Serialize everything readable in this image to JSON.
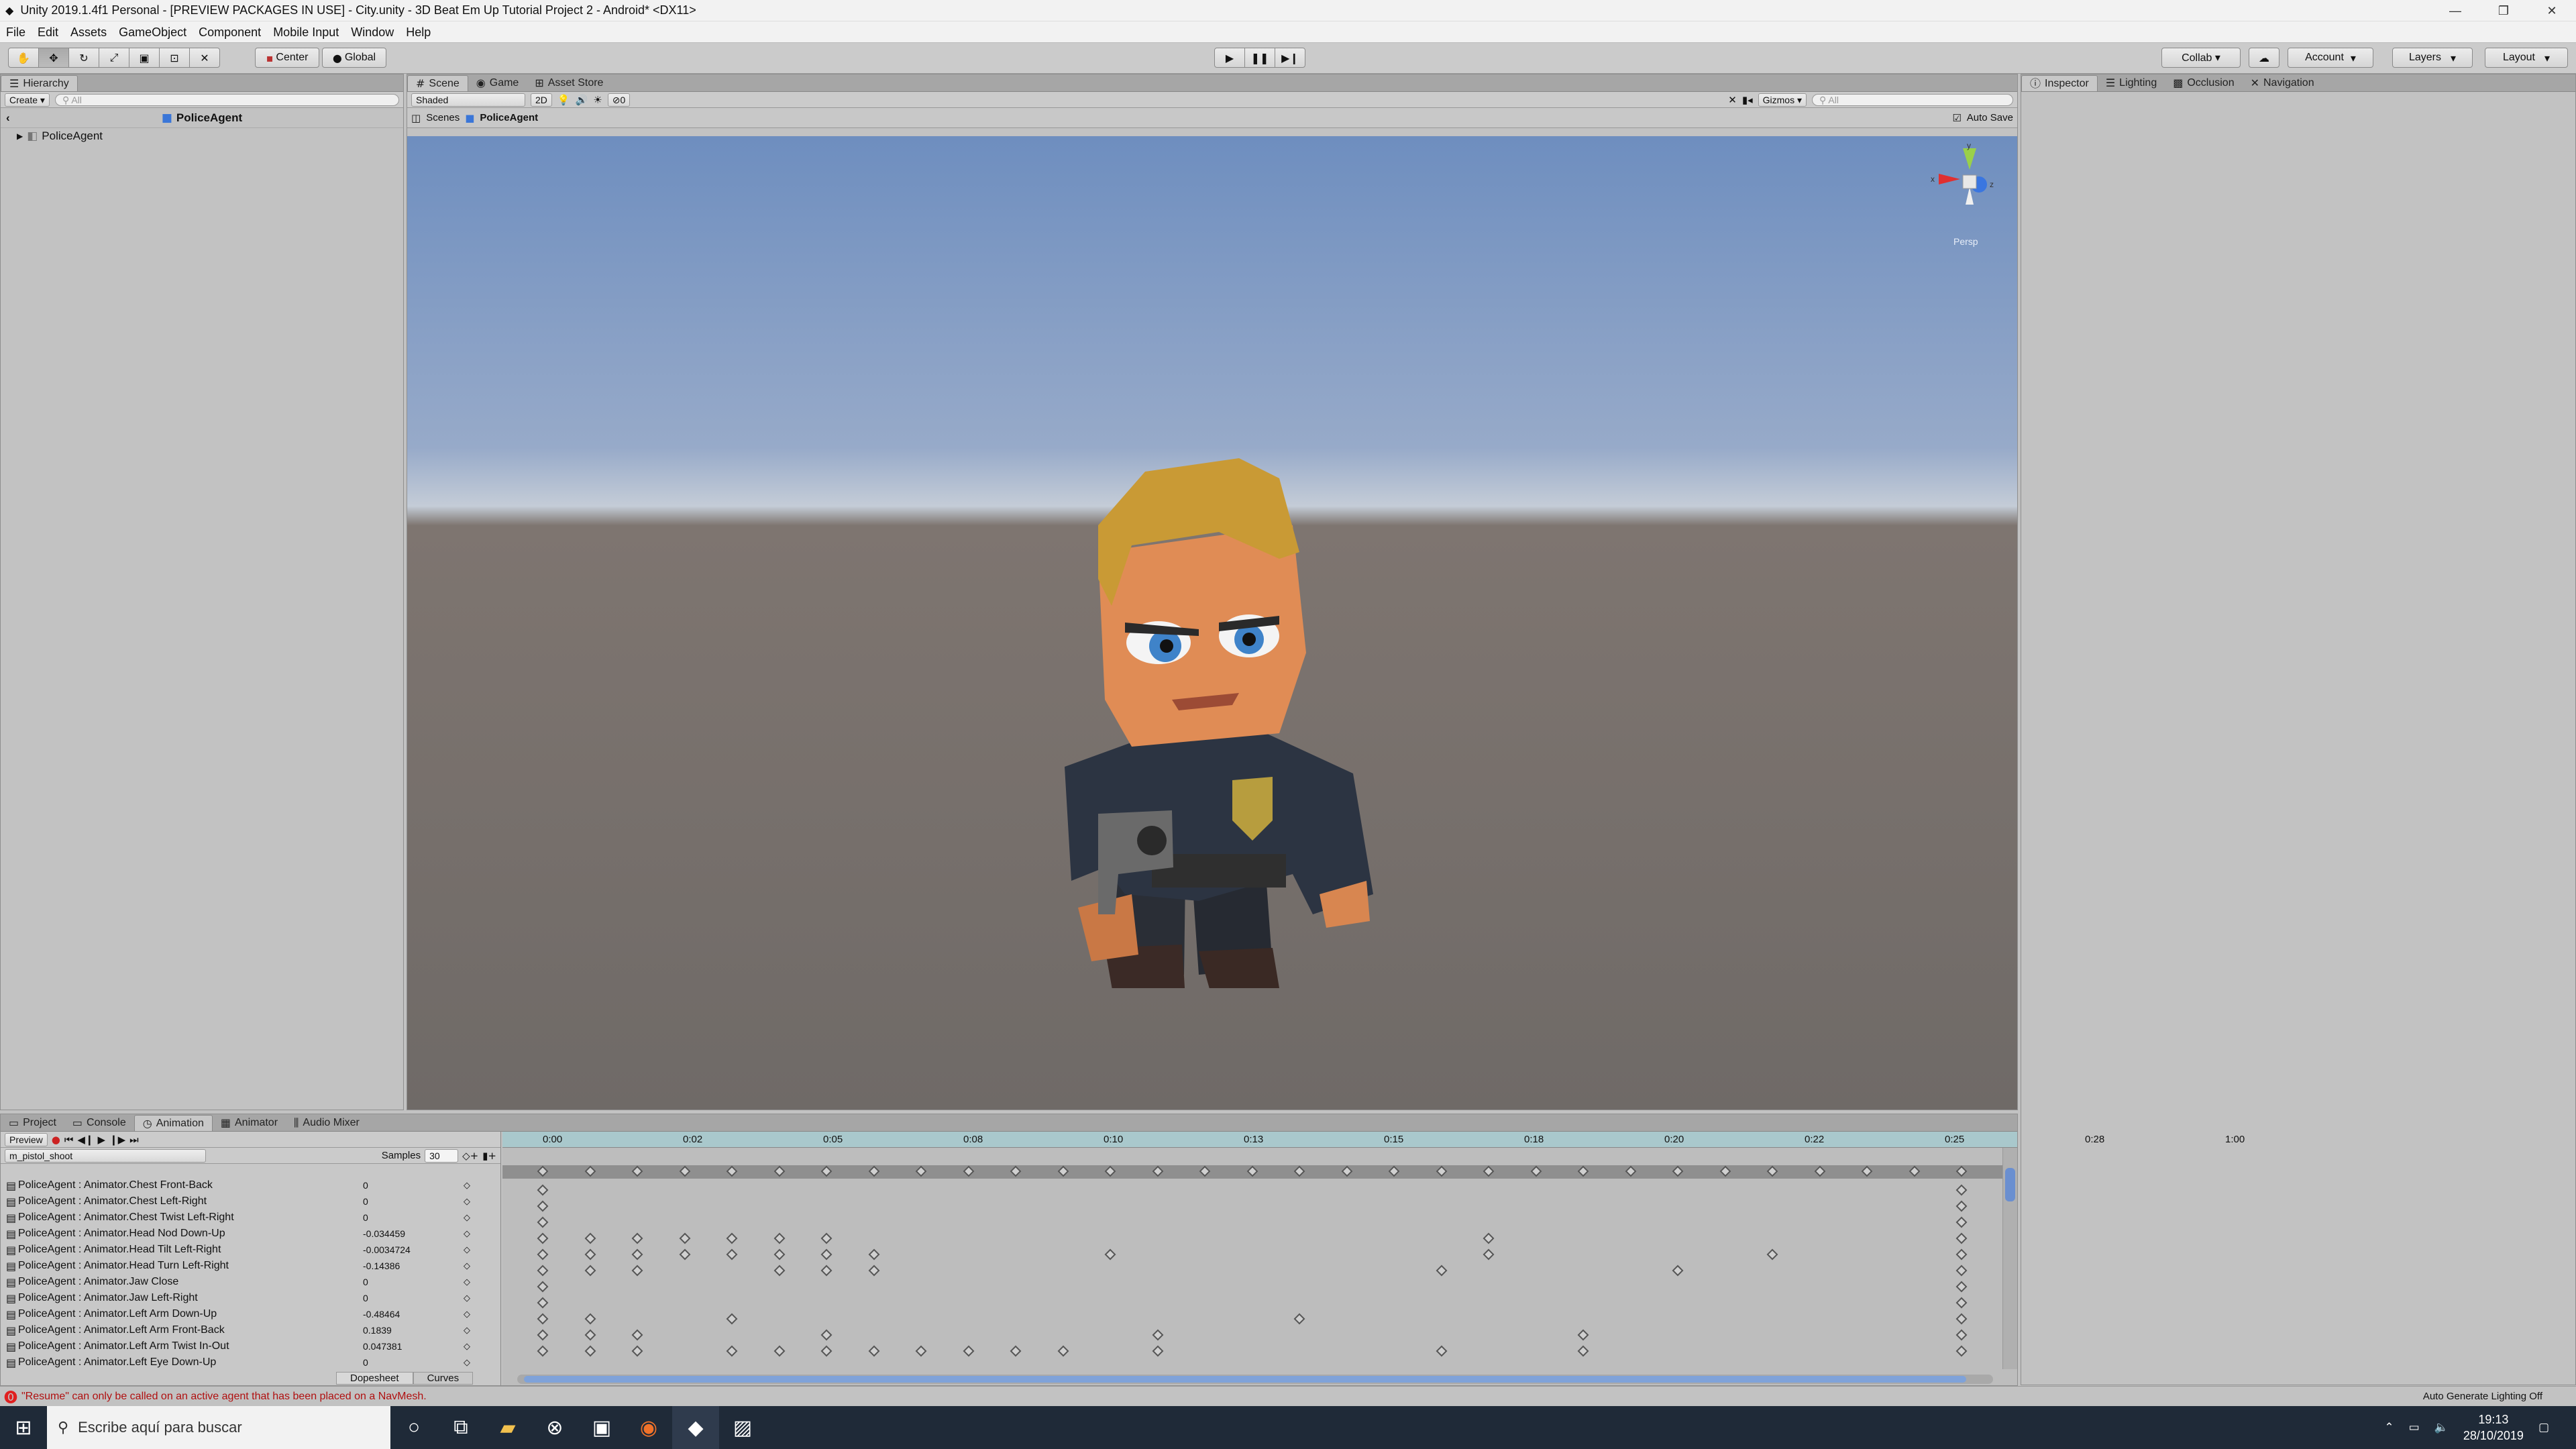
{
  "titlebar": {
    "title": "Unity 2019.1.4f1 Personal - [PREVIEW PACKAGES IN USE] - City.unity - 3D Beat Em Up Tutorial Project 2 - Android* <DX11>",
    "minimize": "—",
    "restore": "❐",
    "close": "✕"
  },
  "menu": [
    "File",
    "Edit",
    "Assets",
    "GameObject",
    "Component",
    "Mobile Input",
    "Window",
    "Help"
  ],
  "toolbar": {
    "pivot": "Center",
    "space": "Global",
    "collab": "Collab ▾",
    "account": "Account",
    "layers": "Layers",
    "layout": "Layout"
  },
  "hierarchy": {
    "tab": "Hierarchy",
    "create": "Create",
    "search_placeholder": "All",
    "context": "PoliceAgent",
    "items": [
      "PoliceAgent"
    ]
  },
  "scene": {
    "tabs": [
      "Scene",
      "Game",
      "Asset Store"
    ],
    "shading": "Shaded",
    "mode_2d": "2D",
    "fx_count": "0",
    "gizmos": "Gizmos",
    "search_placeholder": "All",
    "breadcrumb_root": "Scenes",
    "breadcrumb_item": "PoliceAgent",
    "autosave": "Auto Save",
    "persp": "Persp",
    "gizmo_x": "x",
    "gizmo_y": "y",
    "gizmo_z": "z"
  },
  "inspector": {
    "tabs": [
      "Inspector",
      "Lighting",
      "Occlusion",
      "Navigation"
    ]
  },
  "animation": {
    "tabs": [
      "Project",
      "Console",
      "Animation",
      "Animator",
      "Audio Mixer"
    ],
    "preview": "Preview",
    "clip": "m_pistol_shoot",
    "samples_label": "Samples",
    "samples_value": "30",
    "time_labels": [
      "0:00",
      "0:02",
      "0:05",
      "0:08",
      "0:10",
      "0:13",
      "0:15",
      "0:18",
      "0:20",
      "0:22",
      "0:25",
      "0:28",
      "1:00"
    ],
    "bottom_tabs": [
      "Dopesheet",
      "Curves"
    ],
    "properties": [
      {
        "name": "PoliceAgent : Animator.Chest Front-Back",
        "value": "0"
      },
      {
        "name": "PoliceAgent : Animator.Chest Left-Right",
        "value": "0"
      },
      {
        "name": "PoliceAgent : Animator.Chest Twist Left-Right",
        "value": "0"
      },
      {
        "name": "PoliceAgent : Animator.Head Nod Down-Up",
        "value": "-0.034459"
      },
      {
        "name": "PoliceAgent : Animator.Head Tilt Left-Right",
        "value": "-0.0034724"
      },
      {
        "name": "PoliceAgent : Animator.Head Turn Left-Right",
        "value": "-0.14386"
      },
      {
        "name": "PoliceAgent : Animator.Jaw Close",
        "value": "0"
      },
      {
        "name": "PoliceAgent : Animator.Jaw Left-Right",
        "value": "0"
      },
      {
        "name": "PoliceAgent : Animator.Left Arm Down-Up",
        "value": "-0.48464"
      },
      {
        "name": "PoliceAgent : Animator.Left Arm Front-Back",
        "value": "0.1839"
      },
      {
        "name": "PoliceAgent : Animator.Left Arm Twist In-Out",
        "value": "0.047381"
      },
      {
        "name": "PoliceAgent : Animator.Left Eye Down-Up",
        "value": "0"
      }
    ]
  },
  "status": {
    "message": "\"Resume\" can only be called on an active agent that has been placed on a NavMesh.",
    "right": "Auto Generate Lighting Off"
  },
  "taskbar": {
    "search_placeholder": "Escribe aquí para buscar",
    "time": "19:13",
    "date": "28/10/2019"
  }
}
